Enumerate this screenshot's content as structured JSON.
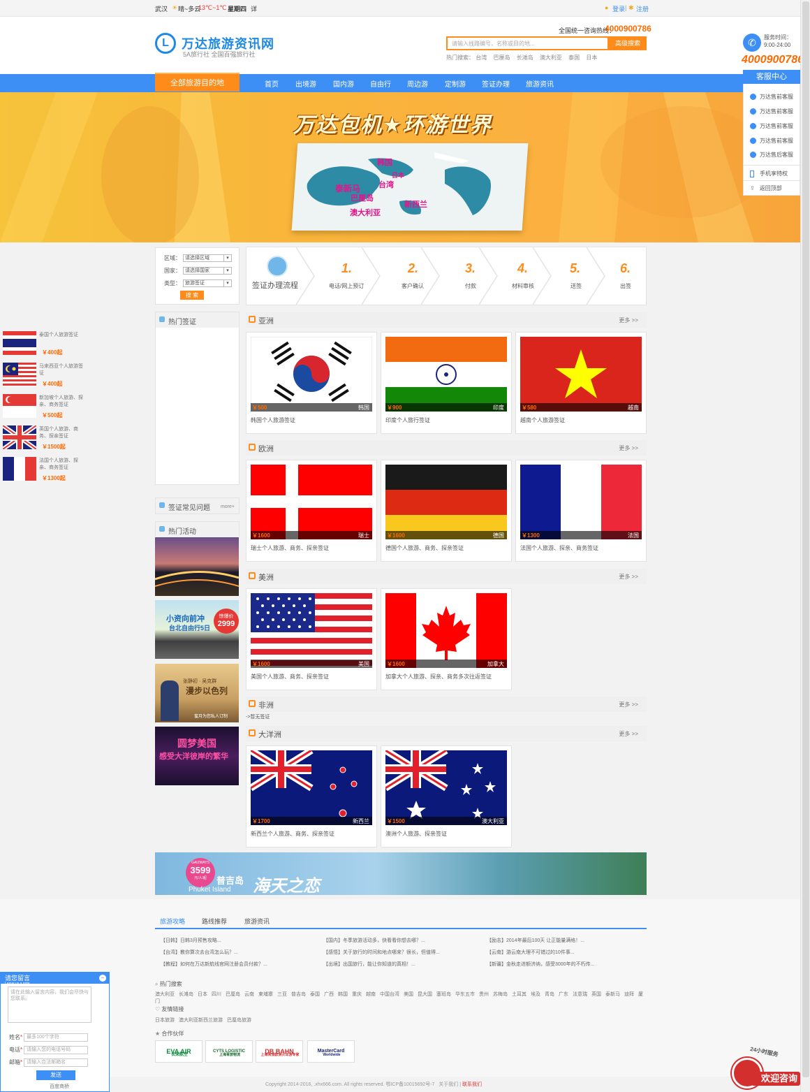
{
  "topbar": {
    "city": "武汉",
    "weather": "晴~多云",
    "temp": "13℃~1℃",
    "weekday": "星期四",
    "detail": "详",
    "login": "登录",
    "sep": "|",
    "register": "注册"
  },
  "header": {
    "logo_mark": "L",
    "site_name": "万达旅游资讯网",
    "site_sub": "5A旅行社   全国百强旅行社",
    "hotline_label": "全国统一咨询热线：",
    "hotline": "4000900786",
    "search_placeholder": "请输入线路编号，名称或目的地...",
    "search_button": "高级搜索",
    "hot_label": "热门搜索：",
    "hot_terms": [
      "台湾",
      "巴厘岛",
      "长滩岛",
      "澳大利亚",
      "泰国",
      "日本"
    ]
  },
  "nav": {
    "all": "全部旅游目的地",
    "items": [
      "首页",
      "出境游",
      "国内游",
      "自由行",
      "周边游",
      "定制游",
      "签证办理",
      "旅游资讯"
    ]
  },
  "banner": {
    "title": "万达包机★环游世界",
    "labels": [
      "韩国",
      "日本",
      "台湾",
      "泰新马",
      "巴厘岛",
      "澳大利亚",
      "新西兰"
    ]
  },
  "service": {
    "time_label": "服务时间：",
    "time": "9:00-24:00",
    "phone": "4000900786",
    "title": "客服中心",
    "items": [
      "万达售前客服",
      "万达售前客服",
      "万达售前客服",
      "万达售前客服",
      "万达售后客服"
    ],
    "mobile": "手机享特权",
    "top": "返回顶部"
  },
  "filter": {
    "region_label": "区域：",
    "region_value": "请选择区域",
    "country_label": "国家：",
    "country_value": "请选择国家",
    "type_label": "类型：",
    "type_value": "旅游签证",
    "button": "搜 索"
  },
  "process": {
    "title": "签证办理流程",
    "steps": [
      {
        "num": "1.",
        "label": "电话/网上预订"
      },
      {
        "num": "2.",
        "label": "客户确认"
      },
      {
        "num": "3.",
        "label": "付款"
      },
      {
        "num": "4.",
        "label": "材料审核"
      },
      {
        "num": "5.",
        "label": "送签"
      },
      {
        "num": "6.",
        "label": "出签"
      }
    ]
  },
  "hot_visa": {
    "title": "热门签证",
    "items": [
      {
        "text": "泰国个人旅游签证",
        "price": "￥400起"
      },
      {
        "text": "马来西亚个人旅游签证",
        "price": "￥400起"
      },
      {
        "text": "新加坡个人旅游、探亲、商务签证",
        "price": "￥500起"
      },
      {
        "text": "英国个人旅游、商务、探亲签证",
        "price": "￥1500起"
      },
      {
        "text": "法国个人旅游、探亲、商务签证",
        "price": "￥1300起"
      }
    ]
  },
  "faq": {
    "title": "签证常见问题",
    "more": "more+"
  },
  "activity": {
    "title": "热门活动",
    "promo2_title": "小资向前冲",
    "promo2_sub": "台北自由行5日",
    "promo2_badge": "惊爆价",
    "promo2_price": "2999",
    "promo3_line1": "张静初 · 吴克群",
    "promo3_line2": "漫步以色列",
    "promo3_line3": "蜜月为您私人订制",
    "promo4_line1": "圆梦美国",
    "promo4_line2": "感受大洋彼岸的繁华"
  },
  "sections": [
    {
      "title": "亚洲",
      "more": "更多 >>",
      "cards": [
        {
          "price": "￥500",
          "country": "韩国",
          "name": "韩国个人旅游签证"
        },
        {
          "price": "￥900",
          "country": "印度",
          "name": "印度个人旅行签证"
        },
        {
          "price": "￥580",
          "country": "越南",
          "name": "越南个人旅游签证"
        }
      ]
    },
    {
      "title": "欧洲",
      "more": "更多 >>",
      "cards": [
        {
          "price": "￥1600",
          "country": "瑞士",
          "name": "瑞士个人旅游、商务、探亲签证"
        },
        {
          "price": "￥1600",
          "country": "德国",
          "name": "德国个人旅游、商务、探亲签证"
        },
        {
          "price": "￥1300",
          "country": "法国",
          "name": "法国个人旅游、探亲、商务签证"
        }
      ]
    },
    {
      "title": "美洲",
      "more": "更多 >>",
      "cards": [
        {
          "price": "￥1600",
          "country": "美国",
          "name": "美国个人旅游、商务、探亲签证"
        },
        {
          "price": "￥1600",
          "country": "加拿大",
          "name": "加拿大个人旅游、探亲、商务多次往返签证"
        }
      ]
    },
    {
      "title": "非洲",
      "more": "更多 >>",
      "empty": "->暂无签证"
    },
    {
      "title": "大洋洲",
      "more": "更多 >>",
      "cards": [
        {
          "price": "￥1700",
          "country": "新西兰",
          "name": "新西兰个人旅游、商务、探亲签证"
        },
        {
          "price": "￥1500",
          "country": "澳大利亚",
          "name": "澳洲个人旅游、探亲签证"
        }
      ]
    }
  ],
  "promo_banner": {
    "price": "3599",
    "badge": "GAIZWAYS",
    "unit": "元/人/起",
    "island_cn": "普吉岛",
    "island_en": "Phuket Island",
    "slogan": "海天之恋"
  },
  "footer": {
    "tabs": [
      "旅游攻略",
      "路线推荐",
      "旅游资讯"
    ],
    "news": [
      [
        "【日韩】日韩3月预售攻略...",
        "【国内】冬季旅游活动多，快看看你想去哪？...",
        "【励志】2014年最后100天 让正能量满格！..."
      ],
      [
        "【台湾】教你算次去台湾怎么玩？...",
        "【感悟】关于旅行的时间和地点哪来？很长，但值得...",
        "【云南】游云南大理不可错过的10件事..."
      ],
      [
        "【教程】如何在万达新航线官网注册会员付款？...",
        "【出境】出国旅行，能让你知道的真相！...",
        "【新疆】金秋走进额济纳，感受3000年的不朽传..."
      ]
    ],
    "hot_search_title": "热门搜索",
    "hot_search": [
      "澳大利亚",
      "长滩岛",
      "日本",
      "四川",
      "巴厘岛",
      "云南",
      "柬埔寨",
      "三亚",
      "普吉岛",
      "泰国",
      "广西",
      "韩国",
      "重庆",
      "越南",
      "中国台湾",
      "美国",
      "昆大国",
      "塞班岛",
      "华东五市",
      "贵州",
      "苏梅岛",
      "土耳其",
      "埃及",
      "青岛",
      "广东",
      "法意瑞",
      "英国",
      "泰新马",
      "迪拜",
      "厦门"
    ],
    "links_title": "友情链接",
    "links": [
      "日本旅游",
      "澳大利亚新西兰旅游",
      "巴厘岛旅游"
    ],
    "partners_title": "合作伙伴",
    "partners": [
      "EVA AIR",
      "CYTS LOGISTIC",
      "DB BAHN",
      "MasterCard"
    ],
    "partner_sub": [
      "长荣航空",
      "上海青旅物流",
      "上海青旅欧洲火车游专家",
      "Worldwide"
    ],
    "copyright": "Copyright 2014-2016, .xhx666.com. All rights reserved. 鄂ICP备10015692号-7",
    "about": "关于我们",
    "contact": "联系我们"
  },
  "message": {
    "title": "请您留言",
    "title_en": "Leave us a note",
    "content_placeholder": "请在此输入留言内容，我们会尽快与您联系。",
    "name_label": "姓名",
    "name_placeholder": "最多100个字符",
    "phone_label": "电话",
    "phone_placeholder": "请输入您的电话号码",
    "email_label": "邮箱",
    "email_placeholder": "请输入合法邮箱名",
    "send": "发送",
    "powered": "百度商桥"
  },
  "welcome": {
    "hours": "24小时服务",
    "text": "欢迎咨询"
  }
}
